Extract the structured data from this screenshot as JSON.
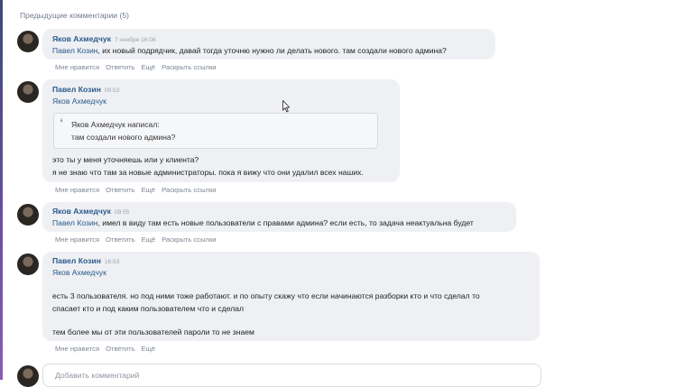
{
  "prev_comments": "Предыдущие комментарии (5)",
  "actions": {
    "like": "Мне нравится",
    "reply": "Ответить",
    "more": "Ещё",
    "expand_links": "Раскрыть ссылки"
  },
  "comments": [
    {
      "author": "Яков Ахмедчук",
      "time": "7 ноября 16:08",
      "mention": "Павел Козин",
      "text": ", их новый подрядчик, давай тогда уточню нужно ли делать нового. там создали нового админа?"
    },
    {
      "author": "Павел Козин",
      "time": "09:53",
      "mention": "Яков Ахмедчук",
      "quote_header": "Яков Ахмедчук написал:",
      "quote_text": "там создали нового админа?",
      "line1": "это ты у меня уточняешь или у клиента?",
      "line2": "я не знаю что там за новые администраторы. пока я вижу что они удалил всех наших."
    },
    {
      "author": "Яков Ахмедчук",
      "time": "09:55",
      "mention": "Павел Козин",
      "text": ", имел в виду там есть новые пользователи с правами админа? если есть, то задача неактуальна будет"
    },
    {
      "author": "Павел Козин",
      "time": "16:53",
      "mention": "Яков Ахмедчук",
      "line1": "есть 3 пользователя. но под ними тоже работают. и по опыту скажу что если начинаются разборки кто и что сделал то",
      "line2": "спасает кто и под каким пользователем что и сделал",
      "line3": "тем более мы от эти пользователей пароли то не знаем"
    }
  ],
  "new_comment": {
    "placeholder": "Добавить комментарий"
  }
}
